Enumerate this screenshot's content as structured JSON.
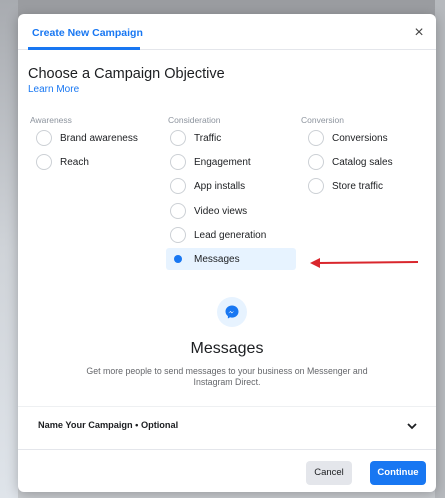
{
  "modal": {
    "tab_label": "Create New Campaign",
    "close_label": "×",
    "heading": "Choose a Campaign Objective",
    "learn_more": "Learn More"
  },
  "columns": [
    {
      "label": "Awareness",
      "options": [
        {
          "label": "Brand awareness",
          "selected": false
        },
        {
          "label": "Reach",
          "selected": false
        }
      ]
    },
    {
      "label": "Consideration",
      "options": [
        {
          "label": "Traffic",
          "selected": false
        },
        {
          "label": "Engagement",
          "selected": false
        },
        {
          "label": "App installs",
          "selected": false
        },
        {
          "label": "Video views",
          "selected": false
        },
        {
          "label": "Lead generation",
          "selected": false
        },
        {
          "label": "Messages",
          "selected": true
        }
      ]
    },
    {
      "label": "Conversion",
      "options": [
        {
          "label": "Conversions",
          "selected": false
        },
        {
          "label": "Catalog sales",
          "selected": false
        },
        {
          "label": "Store traffic",
          "selected": false
        }
      ]
    }
  ],
  "detail": {
    "icon": "messenger-icon",
    "title": "Messages",
    "description": "Get more people to send messages to your business on Messenger and Instagram Direct."
  },
  "name_section": {
    "label": "Name Your Campaign • Optional",
    "icon": "chevron-down-icon"
  },
  "footer": {
    "cancel_label": "Cancel",
    "continue_label": "Continue"
  },
  "colors": {
    "accent": "#1877f2",
    "selected_bg": "#e7f3ff",
    "annotation_arrow": "#d9262c"
  }
}
